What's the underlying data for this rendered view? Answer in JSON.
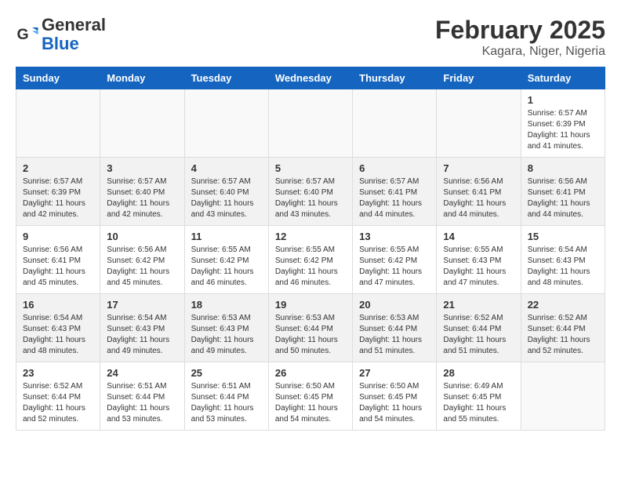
{
  "logo": {
    "line1": "General",
    "line2": "Blue"
  },
  "title": "February 2025",
  "subtitle": "Kagara, Niger, Nigeria",
  "days_of_week": [
    "Sunday",
    "Monday",
    "Tuesday",
    "Wednesday",
    "Thursday",
    "Friday",
    "Saturday"
  ],
  "weeks": [
    [
      {
        "day": "",
        "info": ""
      },
      {
        "day": "",
        "info": ""
      },
      {
        "day": "",
        "info": ""
      },
      {
        "day": "",
        "info": ""
      },
      {
        "day": "",
        "info": ""
      },
      {
        "day": "",
        "info": ""
      },
      {
        "day": "1",
        "info": "Sunrise: 6:57 AM\nSunset: 6:39 PM\nDaylight: 11 hours\nand 41 minutes."
      }
    ],
    [
      {
        "day": "2",
        "info": "Sunrise: 6:57 AM\nSunset: 6:39 PM\nDaylight: 11 hours\nand 42 minutes."
      },
      {
        "day": "3",
        "info": "Sunrise: 6:57 AM\nSunset: 6:40 PM\nDaylight: 11 hours\nand 42 minutes."
      },
      {
        "day": "4",
        "info": "Sunrise: 6:57 AM\nSunset: 6:40 PM\nDaylight: 11 hours\nand 43 minutes."
      },
      {
        "day": "5",
        "info": "Sunrise: 6:57 AM\nSunset: 6:40 PM\nDaylight: 11 hours\nand 43 minutes."
      },
      {
        "day": "6",
        "info": "Sunrise: 6:57 AM\nSunset: 6:41 PM\nDaylight: 11 hours\nand 44 minutes."
      },
      {
        "day": "7",
        "info": "Sunrise: 6:56 AM\nSunset: 6:41 PM\nDaylight: 11 hours\nand 44 minutes."
      },
      {
        "day": "8",
        "info": "Sunrise: 6:56 AM\nSunset: 6:41 PM\nDaylight: 11 hours\nand 44 minutes."
      }
    ],
    [
      {
        "day": "9",
        "info": "Sunrise: 6:56 AM\nSunset: 6:41 PM\nDaylight: 11 hours\nand 45 minutes."
      },
      {
        "day": "10",
        "info": "Sunrise: 6:56 AM\nSunset: 6:42 PM\nDaylight: 11 hours\nand 45 minutes."
      },
      {
        "day": "11",
        "info": "Sunrise: 6:55 AM\nSunset: 6:42 PM\nDaylight: 11 hours\nand 46 minutes."
      },
      {
        "day": "12",
        "info": "Sunrise: 6:55 AM\nSunset: 6:42 PM\nDaylight: 11 hours\nand 46 minutes."
      },
      {
        "day": "13",
        "info": "Sunrise: 6:55 AM\nSunset: 6:42 PM\nDaylight: 11 hours\nand 47 minutes."
      },
      {
        "day": "14",
        "info": "Sunrise: 6:55 AM\nSunset: 6:43 PM\nDaylight: 11 hours\nand 47 minutes."
      },
      {
        "day": "15",
        "info": "Sunrise: 6:54 AM\nSunset: 6:43 PM\nDaylight: 11 hours\nand 48 minutes."
      }
    ],
    [
      {
        "day": "16",
        "info": "Sunrise: 6:54 AM\nSunset: 6:43 PM\nDaylight: 11 hours\nand 48 minutes."
      },
      {
        "day": "17",
        "info": "Sunrise: 6:54 AM\nSunset: 6:43 PM\nDaylight: 11 hours\nand 49 minutes."
      },
      {
        "day": "18",
        "info": "Sunrise: 6:53 AM\nSunset: 6:43 PM\nDaylight: 11 hours\nand 49 minutes."
      },
      {
        "day": "19",
        "info": "Sunrise: 6:53 AM\nSunset: 6:44 PM\nDaylight: 11 hours\nand 50 minutes."
      },
      {
        "day": "20",
        "info": "Sunrise: 6:53 AM\nSunset: 6:44 PM\nDaylight: 11 hours\nand 51 minutes."
      },
      {
        "day": "21",
        "info": "Sunrise: 6:52 AM\nSunset: 6:44 PM\nDaylight: 11 hours\nand 51 minutes."
      },
      {
        "day": "22",
        "info": "Sunrise: 6:52 AM\nSunset: 6:44 PM\nDaylight: 11 hours\nand 52 minutes."
      }
    ],
    [
      {
        "day": "23",
        "info": "Sunrise: 6:52 AM\nSunset: 6:44 PM\nDaylight: 11 hours\nand 52 minutes."
      },
      {
        "day": "24",
        "info": "Sunrise: 6:51 AM\nSunset: 6:44 PM\nDaylight: 11 hours\nand 53 minutes."
      },
      {
        "day": "25",
        "info": "Sunrise: 6:51 AM\nSunset: 6:44 PM\nDaylight: 11 hours\nand 53 minutes."
      },
      {
        "day": "26",
        "info": "Sunrise: 6:50 AM\nSunset: 6:45 PM\nDaylight: 11 hours\nand 54 minutes."
      },
      {
        "day": "27",
        "info": "Sunrise: 6:50 AM\nSunset: 6:45 PM\nDaylight: 11 hours\nand 54 minutes."
      },
      {
        "day": "28",
        "info": "Sunrise: 6:49 AM\nSunset: 6:45 PM\nDaylight: 11 hours\nand 55 minutes."
      },
      {
        "day": "",
        "info": ""
      }
    ]
  ]
}
